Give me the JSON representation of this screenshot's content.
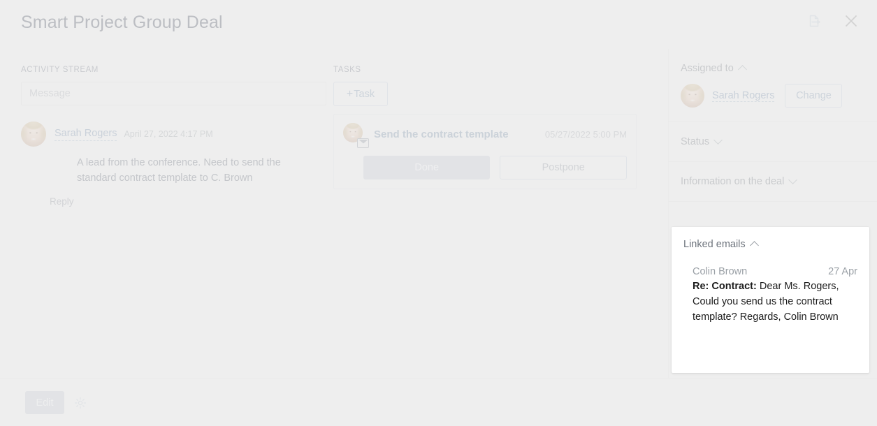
{
  "header": {
    "title": "Smart Project Group Deal",
    "actions": [
      {
        "name": "document-export-icon",
        "label": ""
      },
      {
        "name": "close-icon",
        "label": ""
      }
    ]
  },
  "activity_stream": {
    "label": "ACTIVITY STREAM",
    "message_input": {
      "value": "",
      "placeholder": "Message"
    },
    "items": [
      {
        "author": "Sarah Rogers",
        "date": "April 27, 2022 4:17 PM",
        "body": "A lead from the conference. Need to send the standard contract template to C. Brown",
        "reply_label": "Reply"
      }
    ]
  },
  "tasks": {
    "label": "TASKS",
    "add_label": "Task",
    "add_plus": "+",
    "items": [
      {
        "title": "Send the contract template",
        "date": "05/27/2022 5:00 PM",
        "done_label": "Done",
        "postpone_label": "Postpone"
      }
    ]
  },
  "sidebar": {
    "assigned": {
      "title": "Assigned to",
      "person": "Sarah Rogers",
      "change_label": "Change"
    },
    "status": {
      "title": "Status"
    },
    "information": {
      "title": "Information on the deal"
    }
  },
  "linked_emails": {
    "title": "Linked emails",
    "items": [
      {
        "sender": "Colin Brown",
        "date": "27 Apr",
        "subject": "Re: Contract:",
        "body": "Dear Ms. Rogers, Could you send us the contract template? Regards, Colin Brown"
      }
    ]
  },
  "footer": {
    "edit_label": "Edit",
    "settings_icon": "gear-icon"
  },
  "colors": {
    "background": "#eeeeee",
    "accent_link": "#6f8aa8",
    "button_grey": "#c5c9d2",
    "divider": "#e2e2e2",
    "card_white": "#ffffff"
  }
}
